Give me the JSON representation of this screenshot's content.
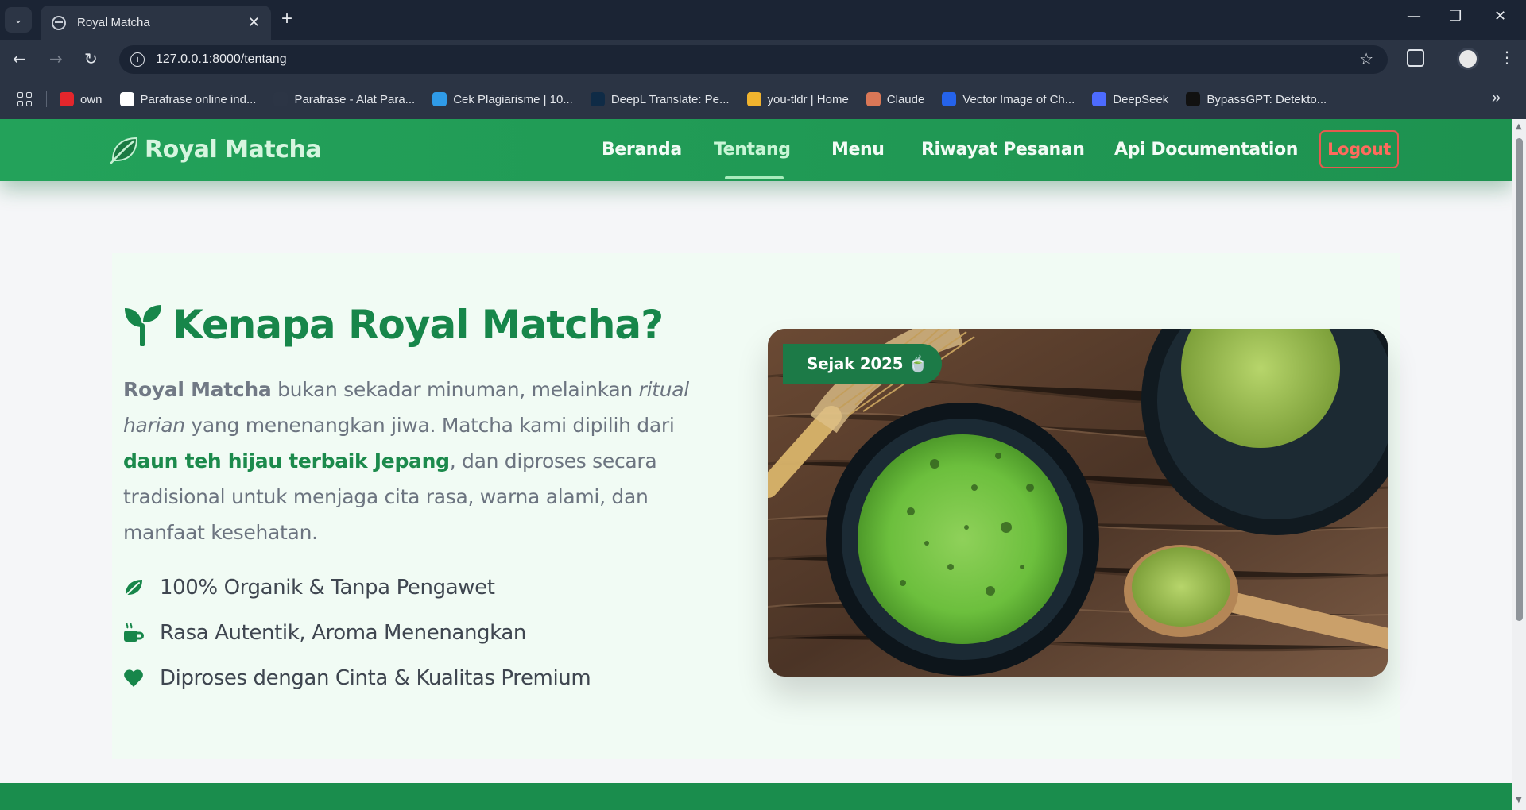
{
  "browser": {
    "tab_title": "Royal Matcha",
    "url": "127.0.0.1:8000/tentang",
    "bookmarks": [
      {
        "label": "own",
        "icon": "youtube-icon",
        "color": "#e3262c"
      },
      {
        "label": "Parafrase online ind...",
        "icon": "document-icon",
        "color": "#ffffff"
      },
      {
        "label": "Parafrase - Alat Para...",
        "icon": "quillbot-icon",
        "color": "#2c3545"
      },
      {
        "label": "Cek Plagiarisme | 10...",
        "icon": "c-icon",
        "color": "#2f9be8"
      },
      {
        "label": "DeepL Translate: Pe...",
        "icon": "deepl-icon",
        "color": "#0f2b46"
      },
      {
        "label": "you-tldr | Home",
        "icon": "you-tldr-icon",
        "color": "#f0b32e"
      },
      {
        "label": "Claude",
        "icon": "claude-icon",
        "color": "#d97757"
      },
      {
        "label": "Vector Image of Ch...",
        "icon": "f-icon",
        "color": "#2563eb"
      },
      {
        "label": "DeepSeek",
        "icon": "deepseek-icon",
        "color": "#4d6bfe"
      },
      {
        "label": "BypassGPT: Detekto...",
        "icon": "b-icon",
        "color": "#111111"
      }
    ]
  },
  "site": {
    "brand": "Royal Matcha",
    "nav": {
      "beranda": "Beranda",
      "tentang": "Tentang",
      "menu": "Menu",
      "riwayat": "Riwayat Pesanan",
      "api": "Api Documentation",
      "logout": "Logout"
    },
    "active_nav": "Tentang",
    "colors": {
      "primary": "#1e9250",
      "heading": "#17864a",
      "logout": "#e55a4e"
    }
  },
  "about": {
    "title": "Kenapa Royal Matcha?",
    "p_brand": "Royal Matcha",
    "p_1": " bukan sekadar minuman, melainkan ",
    "p_italic": "ritual harian",
    "p_2": " yang menenangkan jiwa. Matcha kami dipilih dari ",
    "p_highlight": "daun teh hijau terbaik Jepang",
    "p_3": ", dan diproses secara tradisional untuk menjaga cita rasa, warna alami, dan manfaat kesehatan.",
    "features": [
      {
        "icon": "leaf-icon",
        "text": "100% Organik & Tanpa Pengawet"
      },
      {
        "icon": "mug-icon",
        "text": "Rasa Autentik, Aroma Menenangkan"
      },
      {
        "icon": "heart-icon",
        "text": "Diproses dengan Cinta & Kualitas Premium"
      }
    ],
    "badge": "Sejak 2025 🍵"
  }
}
